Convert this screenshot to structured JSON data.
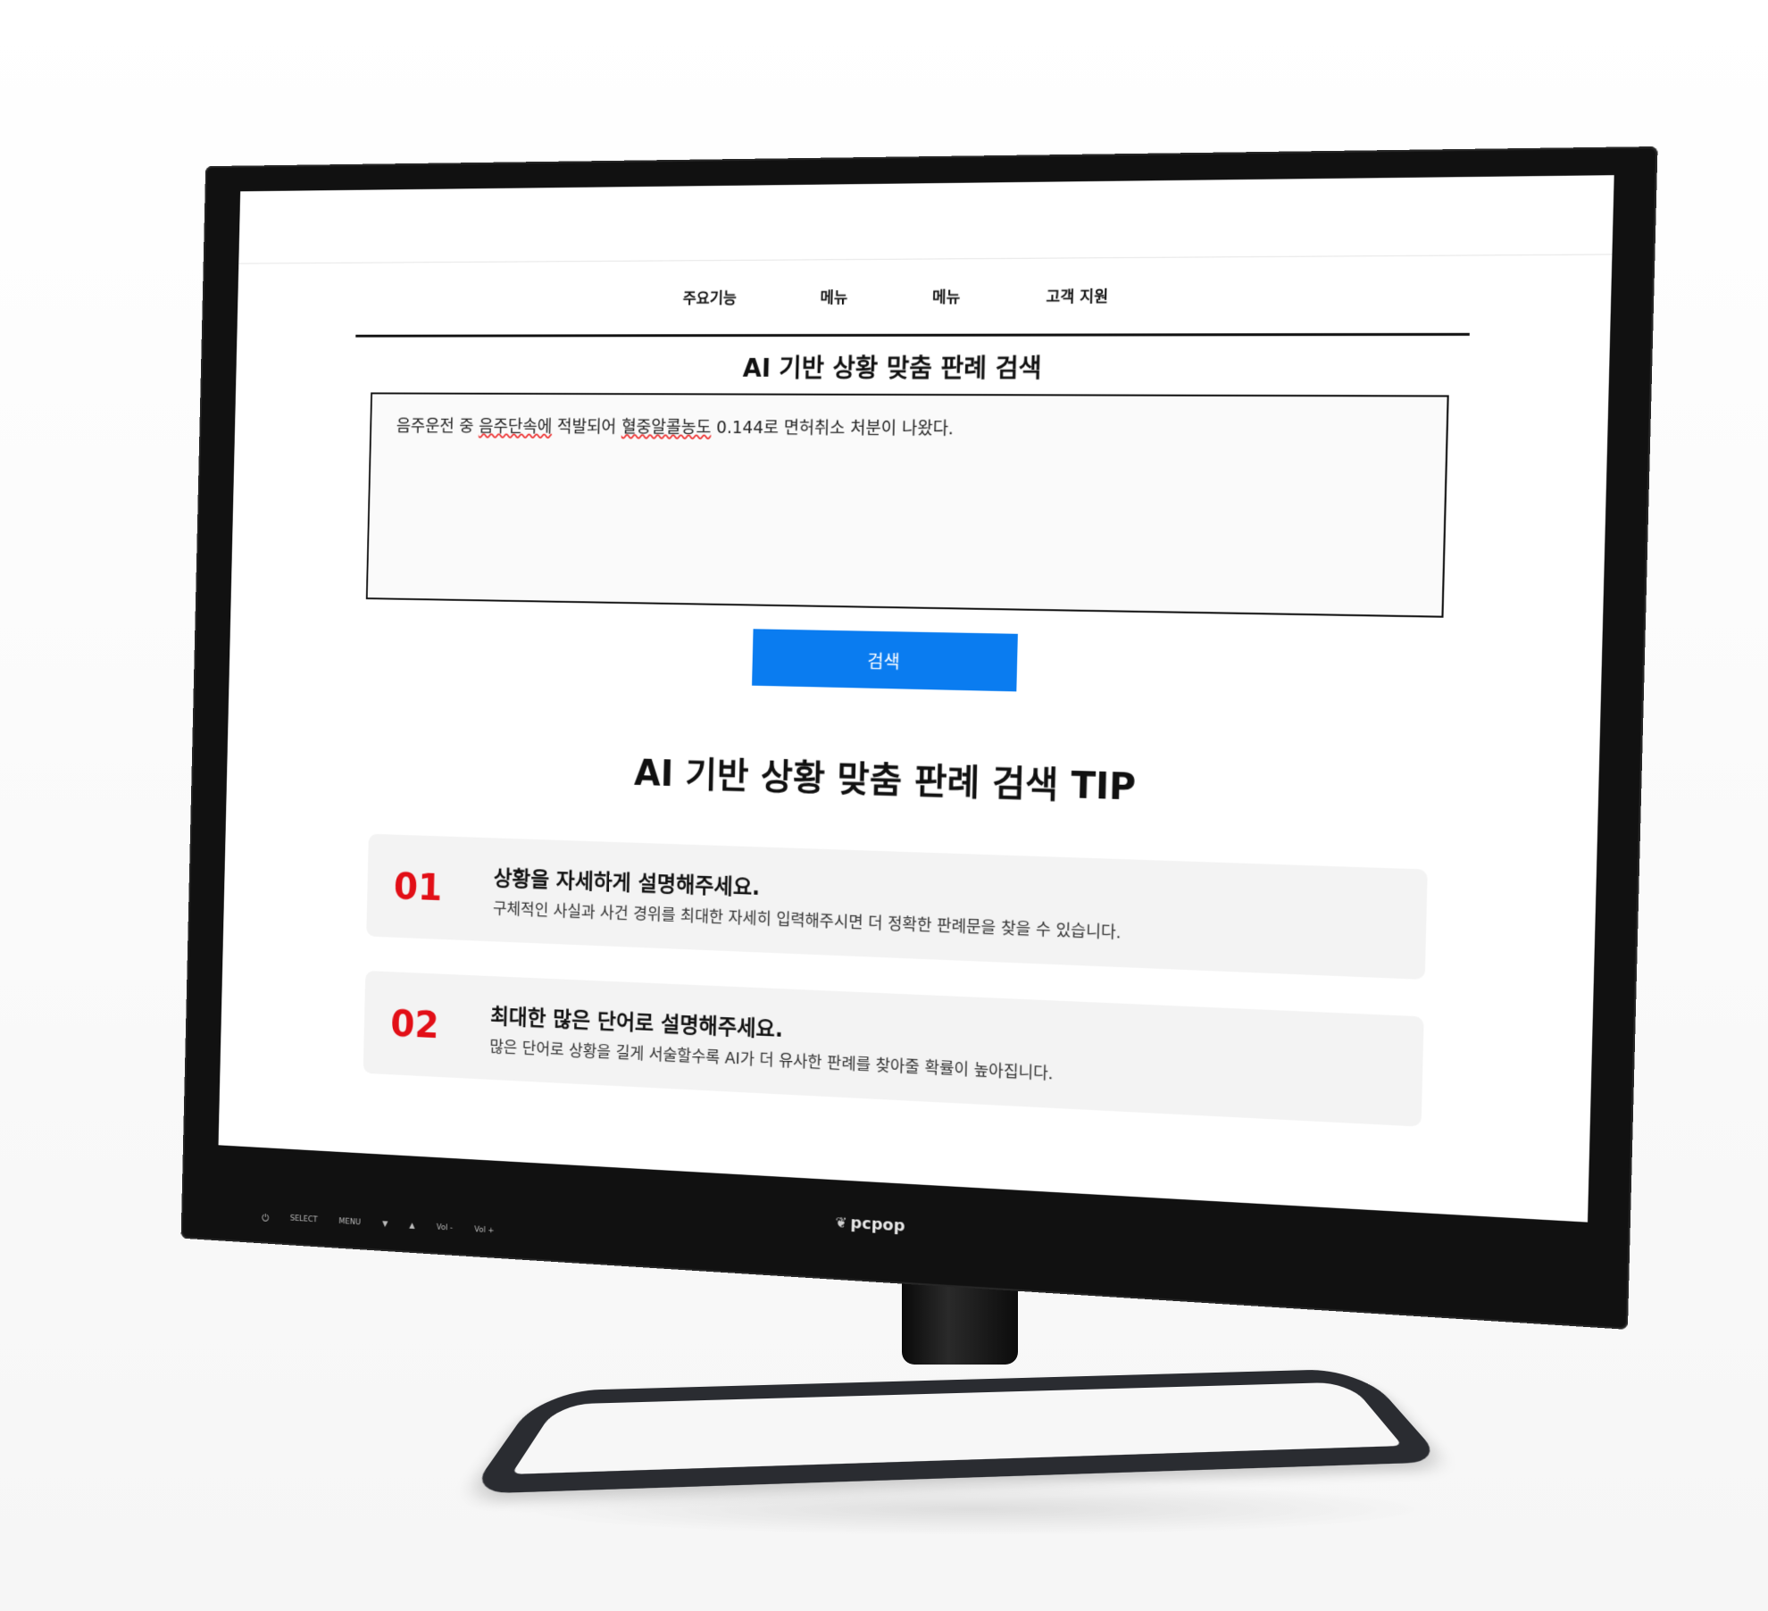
{
  "nav": {
    "items": [
      "주요기능",
      "메뉴",
      "메뉴",
      "고객 지원"
    ]
  },
  "search": {
    "title": "AI 기반 상황 맞춤 판례 검색",
    "query_parts": [
      "음주운전 중 ",
      "음주단속에",
      " 적발되어 ",
      "혈중알콜농도",
      " 0.144로 면허취소 처분이 나왔다."
    ],
    "button_label": "검색"
  },
  "tips": {
    "title": "AI 기반 상황 맞춤 판례 검색 TIP",
    "items": [
      {
        "num": "01",
        "heading": "상황을 자세하게 설명해주세요.",
        "desc": "구체적인 사실과 사건 경위를 최대한 자세히 입력해주시면 더 정확한 판례문을 찾을 수 있습니다."
      },
      {
        "num": "02",
        "heading": "최대한 많은 단어로 설명해주세요.",
        "desc": "많은 단어로 상황을 길게 서술할수록 AI가 더 유사한 판례를 찾아줄 확률이 높아집니다."
      }
    ]
  },
  "monitor": {
    "brand": "pcpop",
    "brand_icon": "leaf-icon",
    "controls": [
      "SELECT",
      "MENU",
      "▼",
      "▲",
      "Vol -",
      "Vol +"
    ],
    "power_icon": "power-icon"
  },
  "colors": {
    "accent": "#0a7cf0",
    "tip_number": "#e20f17",
    "bezel": "#111111"
  }
}
